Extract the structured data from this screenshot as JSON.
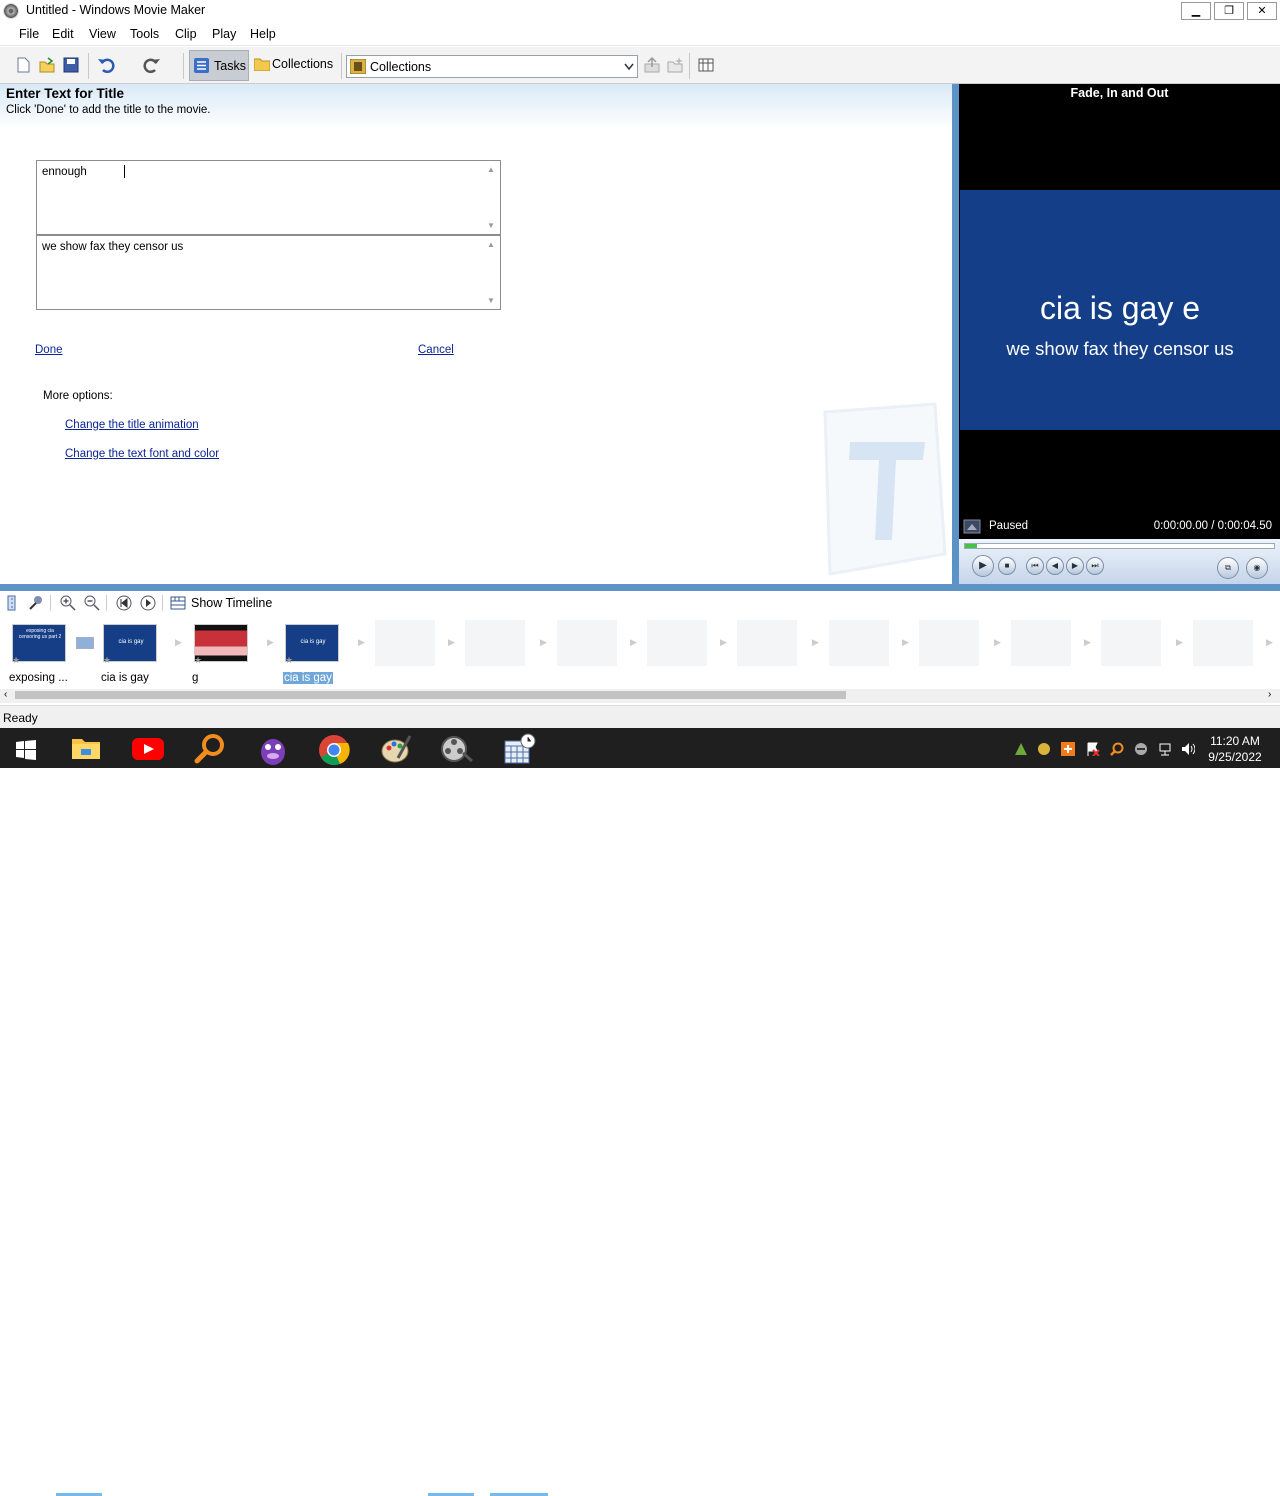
{
  "window": {
    "title": "Untitled - Windows Movie Maker",
    "minimize": "▁",
    "restore": "❐",
    "close": "✕"
  },
  "menu": [
    "File",
    "Edit",
    "View",
    "Tools",
    "Clip",
    "Play",
    "Help"
  ],
  "toolbar": {
    "tasks_label": "Tasks",
    "collections_label": "Collections",
    "collections_select_value": "Collections"
  },
  "task_pane": {
    "heading": "Enter Text for Title",
    "subheading": "Click 'Done' to add the title to the movie.",
    "text1": "ennough ",
    "text2": "we show fax they censor us",
    "done": "Done",
    "cancel": "Cancel",
    "more_options": "More options:",
    "link_animation": "Change the title animation",
    "link_font": "Change the text font and color"
  },
  "preview": {
    "title": "Fade, In and Out",
    "line1": "cia is gay e",
    "line2": "we show fax they censor us",
    "status": "Paused",
    "time": "0:00:00.00 / 0:00:04.50",
    "progress_fraction": 0.0
  },
  "storyboard": {
    "show_timeline": "Show Timeline",
    "clips": [
      {
        "label": "exposing ...",
        "thumb_text": "exposing cia censoring us part 2",
        "thumb_color": "#153e86"
      },
      {
        "label": "cia is gay",
        "thumb_text": "cia is gay",
        "thumb_color": "#153e86"
      },
      {
        "label": "g",
        "thumb_text": "",
        "thumb_color": "#c8313a"
      },
      {
        "label": "cia is gay",
        "thumb_text": "cia is gay",
        "thumb_color": "#153e86",
        "selected": true
      }
    ]
  },
  "status": "Ready",
  "taskbar": {
    "apps": [
      "start-icon",
      "file-explorer-icon",
      "youtube-icon",
      "search-magnifier-icon",
      "bonzi-buddy-icon",
      "chrome-icon",
      "paint-icon",
      "movie-maker-icon",
      "calendar-clock-icon"
    ],
    "time": "11:20 AM",
    "date": "9/25/2022"
  },
  "colors": {
    "accent": "#5b93c7",
    "preview_bg": "#143f88",
    "link": "#0b2596"
  }
}
